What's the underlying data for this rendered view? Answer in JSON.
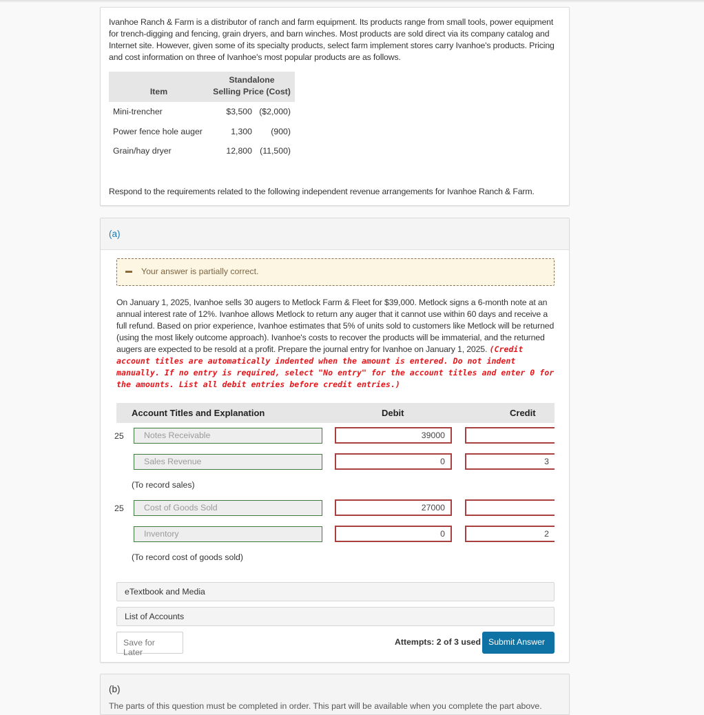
{
  "intro": {
    "paragraph": "Ivanhoe Ranch & Farm is a distributor of ranch and farm equipment. Its products range from small tools, power equipment for trench-digging and fencing, grain dryers, and barn winches. Most products are sold direct via its company catalog and Internet site. However, given some of its specialty products, select farm implement stores carry Ivanhoe's products. Pricing and cost information on three of Ivanhoe's most popular products are as follows.",
    "table": {
      "headers": {
        "item": "Item",
        "price_line1": "Standalone",
        "price_line2": "Selling Price (Cost)"
      },
      "rows": [
        {
          "item": "Mini-trencher",
          "price": "$3,500",
          "cost": "($2,000)"
        },
        {
          "item": "Power fence hole auger",
          "price": "1,300",
          "cost": "(900)"
        },
        {
          "item": "Grain/hay dryer",
          "price": "12,800",
          "cost": "(11,500)"
        }
      ]
    },
    "respond": "Respond to the requirements related to the following independent revenue arrangements for Ivanhoe Ranch & Farm."
  },
  "part_a": {
    "label": "(a)",
    "feedback": "Your answer is partially correct.",
    "question": "On January 1, 2025, Ivanhoe sells 30 augers to Metlock Farm & Fleet for $39,000. Metlock signs a 6-month note at an annual interest rate of 12%. Ivanhoe allows Metlock to return any auger that it cannot use within 60 days and receive a full refund. Based on prior experience, Ivanhoe estimates that 5% of units sold to customers like Metlock will be returned (using the most likely outcome approach). Ivanhoe's costs to recover the products will be immaterial, and the returned augers are expected to be resold at a profit. Prepare the journal entry for Ivanhoe on January 1, 2025. ",
    "instructions": "(Credit account titles are automatically indented when the amount is entered. Do not indent manually. If no entry is required, select \"No entry\" for the account titles and enter 0 for the amounts. List all debit entries before credit entries.)",
    "journal": {
      "headers": {
        "account": "Account Titles and Explanation",
        "debit": "Debit",
        "credit": "Credit"
      },
      "entries": [
        {
          "date_fragment": "25",
          "lines": [
            {
              "account": "Notes Receivable",
              "debit": "39000",
              "credit": ""
            },
            {
              "account": "Sales Revenue",
              "debit": "0",
              "credit": "3"
            }
          ],
          "explanation": "(To record sales)"
        },
        {
          "date_fragment": "25",
          "lines": [
            {
              "account": "Cost of Goods Sold",
              "debit": "27000",
              "credit": ""
            },
            {
              "account": "Inventory",
              "debit": "0",
              "credit": "2"
            }
          ],
          "explanation": "(To record cost of goods sold)"
        }
      ]
    },
    "etextbook": "eTextbook and Media",
    "list_accounts": "List of Accounts",
    "save_label": "Save for Later",
    "attempts": "Attempts: 2 of 3 used",
    "submit_label": "Submit Answer"
  },
  "part_b": {
    "label": "(b)",
    "text": "The parts of this question must be completed in order. This part will be available when you complete the part above."
  }
}
